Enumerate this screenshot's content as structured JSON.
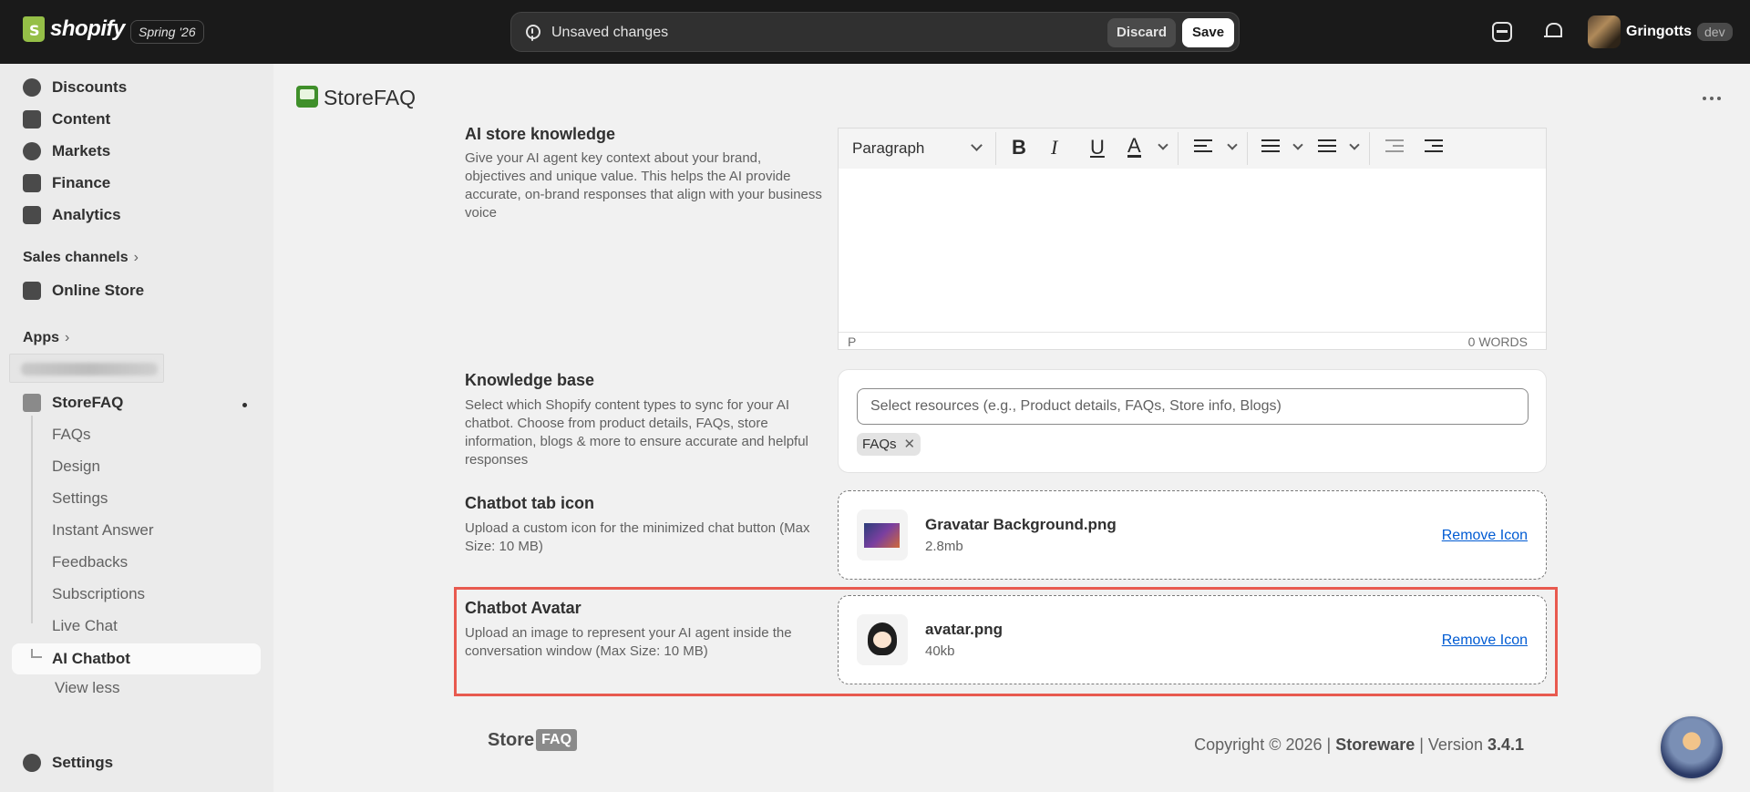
{
  "topbar": {
    "brand": "shopify",
    "edition": "Spring '26",
    "savebar": {
      "message": "Unsaved changes",
      "discard": "Discard",
      "save": "Save"
    },
    "user": {
      "name": "Gringotts",
      "badge": "dev"
    }
  },
  "sidebar": {
    "top_items": [
      {
        "label": "Discounts",
        "icon": "discount-icon"
      },
      {
        "label": "Content",
        "icon": "content-icon"
      },
      {
        "label": "Markets",
        "icon": "globe-icon"
      },
      {
        "label": "Finance",
        "icon": "bank-icon"
      },
      {
        "label": "Analytics",
        "icon": "chart-icon"
      }
    ],
    "sales_channels": "Sales channels",
    "online_store": "Online Store",
    "apps": "Apps",
    "blurred_app": "StoreFAQ dev",
    "app": {
      "name": "StoreFAQ",
      "subitems": [
        "FAQs",
        "Design",
        "Settings",
        "Instant Answer",
        "Feedbacks",
        "Subscriptions",
        "Live Chat"
      ],
      "active": "AI Chatbot",
      "view_less": "View less"
    },
    "settings": "Settings"
  },
  "app_header": {
    "title": "StoreFAQ"
  },
  "sections": {
    "knowledge": {
      "title": "AI store knowledge",
      "desc": "Give your AI agent key context about your brand, objectives and unique value. This helps the AI provide accurate, on-brand responses that align with your business voice",
      "editor": {
        "paragraph": "Paragraph",
        "status_tag": "P",
        "word_count": "0 WORDS"
      }
    },
    "knowledge_base": {
      "title": "Knowledge base",
      "desc": "Select which Shopify content types to sync for your AI chatbot. Choose from product details, FAQs, store information, blogs & more to ensure accurate and helpful responses",
      "placeholder": "Select resources (e.g., Product details, FAQs, Store info, Blogs)",
      "tag": "FAQs"
    },
    "tab_icon": {
      "title": "Chatbot tab icon",
      "desc": "Upload a custom icon for the minimized chat button (Max Size: 10 MB)",
      "file_name": "Gravatar Background.png",
      "file_size": "2.8mb",
      "remove": "Remove Icon"
    },
    "avatar": {
      "title": "Chatbot Avatar",
      "desc": "Upload an image to represent your AI agent inside the conversation window (Max Size: 10 MB)",
      "file_name": "avatar.png",
      "file_size": "40kb",
      "remove": "Remove Icon"
    }
  },
  "footer": {
    "logo_store": "Store",
    "logo_faq": "FAQ",
    "copy_prefix": "Copyright © 2026 | ",
    "company": "Storeware",
    "version_prefix": " | Version ",
    "version": "3.4.1"
  },
  "colors": {
    "accent_link": "#005bd3",
    "highlight": "#e85a4f",
    "topbar": "#1a1a1a"
  }
}
